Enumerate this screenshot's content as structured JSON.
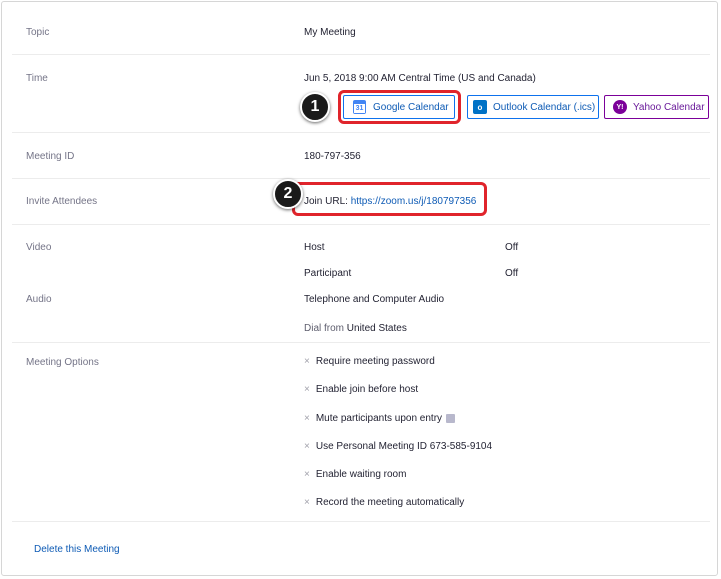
{
  "topic": {
    "label": "Topic",
    "value": "My Meeting"
  },
  "time": {
    "label": "Time",
    "value": "Jun 5, 2018 9:00 AM Central Time (US and Canada)",
    "buttons": {
      "google": "Google Calendar",
      "outlook": "Outlook Calendar (.ics)",
      "yahoo": "Yahoo Calendar"
    },
    "google_icon_text": "31",
    "outlook_icon_text": "o",
    "yahoo_icon_text": "Y!"
  },
  "meeting_id": {
    "label": "Meeting ID",
    "value": "180-797-356"
  },
  "invite": {
    "label": "Invite Attendees",
    "prefix": "Join URL:",
    "url": "https://zoom.us/j/180797356"
  },
  "video": {
    "label": "Video",
    "host_label": "Host",
    "host_value": "Off",
    "participant_label": "Participant",
    "participant_value": "Off"
  },
  "audio": {
    "label": "Audio",
    "value": "Telephone and Computer Audio",
    "dial_prefix": "Dial from",
    "dial_country": "United States"
  },
  "options": {
    "label": "Meeting Options",
    "items": [
      "Require meeting password",
      "Enable join before host",
      "Mute participants upon entry",
      "Use Personal Meeting ID 673-585-9104",
      "Enable waiting room",
      "Record the meeting automatically"
    ],
    "x_glyph": "×"
  },
  "delete_link": "Delete this Meeting",
  "callouts": {
    "one": "1",
    "two": "2"
  },
  "colors": {
    "highlight": "#e0242b",
    "link": "#0e5bb5",
    "callout": "#1a1a1a"
  }
}
